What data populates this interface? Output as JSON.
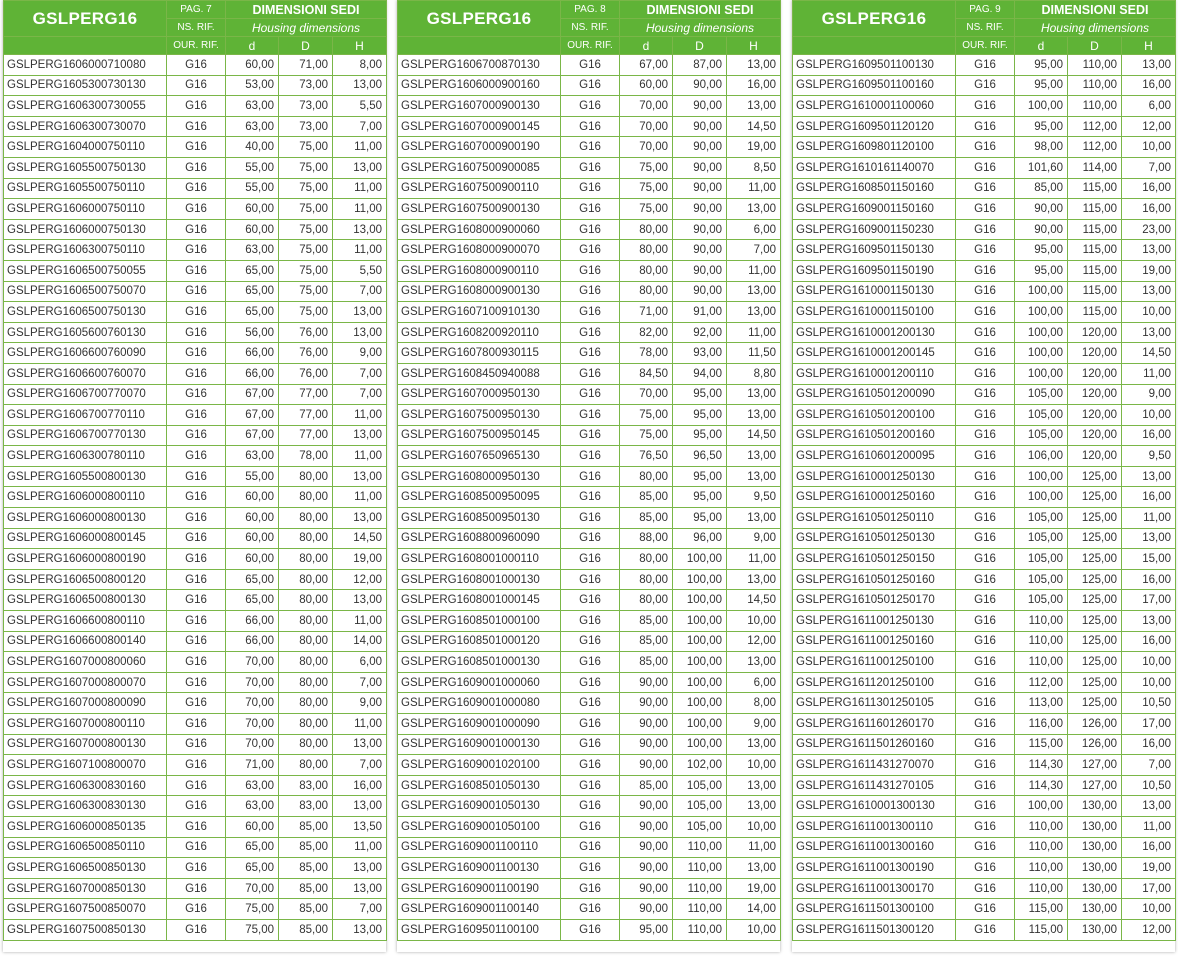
{
  "header": {
    "title": "GSLPERG16",
    "dim_title": "DIMENSIONI SEDI",
    "dim_subtitle": "Housing dimensions",
    "ns_rif": "NS. RIF.",
    "our_rif": "OUR. RIF.",
    "col_d": "d",
    "col_D": "D",
    "col_H": "H"
  },
  "tables": [
    {
      "page": "PAG. 7",
      "rows": [
        [
          "GSLPERG1606000710080",
          "G16",
          "60,00",
          "71,00",
          "8,00"
        ],
        [
          "GSLPERG1605300730130",
          "G16",
          "53,00",
          "73,00",
          "13,00"
        ],
        [
          "GSLPERG1606300730055",
          "G16",
          "63,00",
          "73,00",
          "5,50"
        ],
        [
          "GSLPERG1606300730070",
          "G16",
          "63,00",
          "73,00",
          "7,00"
        ],
        [
          "GSLPERG1604000750110",
          "G16",
          "40,00",
          "75,00",
          "11,00"
        ],
        [
          "GSLPERG1605500750130",
          "G16",
          "55,00",
          "75,00",
          "13,00"
        ],
        [
          "GSLPERG1605500750110",
          "G16",
          "55,00",
          "75,00",
          "11,00"
        ],
        [
          "GSLPERG1606000750110",
          "G16",
          "60,00",
          "75,00",
          "11,00"
        ],
        [
          "GSLPERG1606000750130",
          "G16",
          "60,00",
          "75,00",
          "13,00"
        ],
        [
          "GSLPERG1606300750110",
          "G16",
          "63,00",
          "75,00",
          "11,00"
        ],
        [
          "GSLPERG1606500750055",
          "G16",
          "65,00",
          "75,00",
          "5,50"
        ],
        [
          "GSLPERG1606500750070",
          "G16",
          "65,00",
          "75,00",
          "7,00"
        ],
        [
          "GSLPERG1606500750130",
          "G16",
          "65,00",
          "75,00",
          "13,00"
        ],
        [
          "GSLPERG1605600760130",
          "G16",
          "56,00",
          "76,00",
          "13,00"
        ],
        [
          "GSLPERG1606600760090",
          "G16",
          "66,00",
          "76,00",
          "9,00"
        ],
        [
          "GSLPERG1606600760070",
          "G16",
          "66,00",
          "76,00",
          "7,00"
        ],
        [
          "GSLPERG1606700770070",
          "G16",
          "67,00",
          "77,00",
          "7,00"
        ],
        [
          "GSLPERG1606700770110",
          "G16",
          "67,00",
          "77,00",
          "11,00"
        ],
        [
          "GSLPERG1606700770130",
          "G16",
          "67,00",
          "77,00",
          "13,00"
        ],
        [
          "GSLPERG1606300780110",
          "G16",
          "63,00",
          "78,00",
          "11,00"
        ],
        [
          "GSLPERG1605500800130",
          "G16",
          "55,00",
          "80,00",
          "13,00"
        ],
        [
          "GSLPERG1606000800110",
          "G16",
          "60,00",
          "80,00",
          "11,00"
        ],
        [
          "GSLPERG1606000800130",
          "G16",
          "60,00",
          "80,00",
          "13,00"
        ],
        [
          "GSLPERG1606000800145",
          "G16",
          "60,00",
          "80,00",
          "14,50"
        ],
        [
          "GSLPERG1606000800190",
          "G16",
          "60,00",
          "80,00",
          "19,00"
        ],
        [
          "GSLPERG1606500800120",
          "G16",
          "65,00",
          "80,00",
          "12,00"
        ],
        [
          "GSLPERG1606500800130",
          "G16",
          "65,00",
          "80,00",
          "13,00"
        ],
        [
          "GSLPERG1606600800110",
          "G16",
          "66,00",
          "80,00",
          "11,00"
        ],
        [
          "GSLPERG1606600800140",
          "G16",
          "66,00",
          "80,00",
          "14,00"
        ],
        [
          "GSLPERG1607000800060",
          "G16",
          "70,00",
          "80,00",
          "6,00"
        ],
        [
          "GSLPERG1607000800070",
          "G16",
          "70,00",
          "80,00",
          "7,00"
        ],
        [
          "GSLPERG1607000800090",
          "G16",
          "70,00",
          "80,00",
          "9,00"
        ],
        [
          "GSLPERG1607000800110",
          "G16",
          "70,00",
          "80,00",
          "11,00"
        ],
        [
          "GSLPERG1607000800130",
          "G16",
          "70,00",
          "80,00",
          "13,00"
        ],
        [
          "GSLPERG1607100800070",
          "G16",
          "71,00",
          "80,00",
          "7,00"
        ],
        [
          "GSLPERG1606300830160",
          "G16",
          "63,00",
          "83,00",
          "16,00"
        ],
        [
          "GSLPERG1606300830130",
          "G16",
          "63,00",
          "83,00",
          "13,00"
        ],
        [
          "GSLPERG1606000850135",
          "G16",
          "60,00",
          "85,00",
          "13,50"
        ],
        [
          "GSLPERG1606500850110",
          "G16",
          "65,00",
          "85,00",
          "11,00"
        ],
        [
          "GSLPERG1606500850130",
          "G16",
          "65,00",
          "85,00",
          "13,00"
        ],
        [
          "GSLPERG1607000850130",
          "G16",
          "70,00",
          "85,00",
          "13,00"
        ],
        [
          "GSLPERG1607500850070",
          "G16",
          "75,00",
          "85,00",
          "7,00"
        ],
        [
          "GSLPERG1607500850130",
          "G16",
          "75,00",
          "85,00",
          "13,00"
        ]
      ]
    },
    {
      "page": "PAG. 8",
      "rows": [
        [
          "GSLPERG1606700870130",
          "G16",
          "67,00",
          "87,00",
          "13,00"
        ],
        [
          "GSLPERG1606000900160",
          "G16",
          "60,00",
          "90,00",
          "16,00"
        ],
        [
          "GSLPERG1607000900130",
          "G16",
          "70,00",
          "90,00",
          "13,00"
        ],
        [
          "GSLPERG1607000900145",
          "G16",
          "70,00",
          "90,00",
          "14,50"
        ],
        [
          "GSLPERG1607000900190",
          "G16",
          "70,00",
          "90,00",
          "19,00"
        ],
        [
          "GSLPERG1607500900085",
          "G16",
          "75,00",
          "90,00",
          "8,50"
        ],
        [
          "GSLPERG1607500900110",
          "G16",
          "75,00",
          "90,00",
          "11,00"
        ],
        [
          "GSLPERG1607500900130",
          "G16",
          "75,00",
          "90,00",
          "13,00"
        ],
        [
          "GSLPERG1608000900060",
          "G16",
          "80,00",
          "90,00",
          "6,00"
        ],
        [
          "GSLPERG1608000900070",
          "G16",
          "80,00",
          "90,00",
          "7,00"
        ],
        [
          "GSLPERG1608000900110",
          "G16",
          "80,00",
          "90,00",
          "11,00"
        ],
        [
          "GSLPERG1608000900130",
          "G16",
          "80,00",
          "90,00",
          "13,00"
        ],
        [
          "GSLPERG1607100910130",
          "G16",
          "71,00",
          "91,00",
          "13,00"
        ],
        [
          "GSLPERG1608200920110",
          "G16",
          "82,00",
          "92,00",
          "11,00"
        ],
        [
          "GSLPERG1607800930115",
          "G16",
          "78,00",
          "93,00",
          "11,50"
        ],
        [
          "GSLPERG1608450940088",
          "G16",
          "84,50",
          "94,00",
          "8,80"
        ],
        [
          "GSLPERG1607000950130",
          "G16",
          "70,00",
          "95,00",
          "13,00"
        ],
        [
          "GSLPERG1607500950130",
          "G16",
          "75,00",
          "95,00",
          "13,00"
        ],
        [
          "GSLPERG1607500950145",
          "G16",
          "75,00",
          "95,00",
          "14,50"
        ],
        [
          "GSLPERG1607650965130",
          "G16",
          "76,50",
          "96,50",
          "13,00"
        ],
        [
          "GSLPERG1608000950130",
          "G16",
          "80,00",
          "95,00",
          "13,00"
        ],
        [
          "GSLPERG1608500950095",
          "G16",
          "85,00",
          "95,00",
          "9,50"
        ],
        [
          "GSLPERG1608500950130",
          "G16",
          "85,00",
          "95,00",
          "13,00"
        ],
        [
          "GSLPERG1608800960090",
          "G16",
          "88,00",
          "96,00",
          "9,00"
        ],
        [
          "GSLPERG1608001000110",
          "G16",
          "80,00",
          "100,00",
          "11,00"
        ],
        [
          "GSLPERG1608001000130",
          "G16",
          "80,00",
          "100,00",
          "13,00"
        ],
        [
          "GSLPERG1608001000145",
          "G16",
          "80,00",
          "100,00",
          "14,50"
        ],
        [
          "GSLPERG1608501000100",
          "G16",
          "85,00",
          "100,00",
          "10,00"
        ],
        [
          "GSLPERG1608501000120",
          "G16",
          "85,00",
          "100,00",
          "12,00"
        ],
        [
          "GSLPERG1608501000130",
          "G16",
          "85,00",
          "100,00",
          "13,00"
        ],
        [
          "GSLPERG1609001000060",
          "G16",
          "90,00",
          "100,00",
          "6,00"
        ],
        [
          "GSLPERG1609001000080",
          "G16",
          "90,00",
          "100,00",
          "8,00"
        ],
        [
          "GSLPERG1609001000090",
          "G16",
          "90,00",
          "100,00",
          "9,00"
        ],
        [
          "GSLPERG1609001000130",
          "G16",
          "90,00",
          "100,00",
          "13,00"
        ],
        [
          "GSLPERG1609001020100",
          "G16",
          "90,00",
          "102,00",
          "10,00"
        ],
        [
          "GSLPERG1608501050130",
          "G16",
          "85,00",
          "105,00",
          "13,00"
        ],
        [
          "GSLPERG1609001050130",
          "G16",
          "90,00",
          "105,00",
          "13,00"
        ],
        [
          "GSLPERG1609001050100",
          "G16",
          "90,00",
          "105,00",
          "10,00"
        ],
        [
          "GSLPERG1609001100110",
          "G16",
          "90,00",
          "110,00",
          "11,00"
        ],
        [
          "GSLPERG1609001100130",
          "G16",
          "90,00",
          "110,00",
          "13,00"
        ],
        [
          "GSLPERG1609001100190",
          "G16",
          "90,00",
          "110,00",
          "19,00"
        ],
        [
          "GSLPERG1609001100140",
          "G16",
          "90,00",
          "110,00",
          "14,00"
        ],
        [
          "GSLPERG1609501100100",
          "G16",
          "95,00",
          "110,00",
          "10,00"
        ]
      ]
    },
    {
      "page": "PAG. 9",
      "rows": [
        [
          "GSLPERG1609501100130",
          "G16",
          "95,00",
          "110,00",
          "13,00"
        ],
        [
          "GSLPERG1609501100160",
          "G16",
          "95,00",
          "110,00",
          "16,00"
        ],
        [
          "GSLPERG1610001100060",
          "G16",
          "100,00",
          "110,00",
          "6,00"
        ],
        [
          "GSLPERG1609501120120",
          "G16",
          "95,00",
          "112,00",
          "12,00"
        ],
        [
          "GSLPERG1609801120100",
          "G16",
          "98,00",
          "112,00",
          "10,00"
        ],
        [
          "GSLPERG1610161140070",
          "G16",
          "101,60",
          "114,00",
          "7,00"
        ],
        [
          "GSLPERG1608501150160",
          "G16",
          "85,00",
          "115,00",
          "16,00"
        ],
        [
          "GSLPERG1609001150160",
          "G16",
          "90,00",
          "115,00",
          "16,00"
        ],
        [
          "GSLPERG1609001150230",
          "G16",
          "90,00",
          "115,00",
          "23,00"
        ],
        [
          "GSLPERG1609501150130",
          "G16",
          "95,00",
          "115,00",
          "13,00"
        ],
        [
          "GSLPERG1609501150190",
          "G16",
          "95,00",
          "115,00",
          "19,00"
        ],
        [
          "GSLPERG1610001150130",
          "G16",
          "100,00",
          "115,00",
          "13,00"
        ],
        [
          "GSLPERG1610001150100",
          "G16",
          "100,00",
          "115,00",
          "10,00"
        ],
        [
          "GSLPERG1610001200130",
          "G16",
          "100,00",
          "120,00",
          "13,00"
        ],
        [
          "GSLPERG1610001200145",
          "G16",
          "100,00",
          "120,00",
          "14,50"
        ],
        [
          "GSLPERG1610001200110",
          "G16",
          "100,00",
          "120,00",
          "11,00"
        ],
        [
          "GSLPERG1610501200090",
          "G16",
          "105,00",
          "120,00",
          "9,00"
        ],
        [
          "GSLPERG1610501200100",
          "G16",
          "105,00",
          "120,00",
          "10,00"
        ],
        [
          "GSLPERG1610501200160",
          "G16",
          "105,00",
          "120,00",
          "16,00"
        ],
        [
          "GSLPERG1610601200095",
          "G16",
          "106,00",
          "120,00",
          "9,50"
        ],
        [
          "GSLPERG1610001250130",
          "G16",
          "100,00",
          "125,00",
          "13,00"
        ],
        [
          "GSLPERG1610001250160",
          "G16",
          "100,00",
          "125,00",
          "16,00"
        ],
        [
          "GSLPERG1610501250110",
          "G16",
          "105,00",
          "125,00",
          "11,00"
        ],
        [
          "GSLPERG1610501250130",
          "G16",
          "105,00",
          "125,00",
          "13,00"
        ],
        [
          "GSLPERG1610501250150",
          "G16",
          "105,00",
          "125,00",
          "15,00"
        ],
        [
          "GSLPERG1610501250160",
          "G16",
          "105,00",
          "125,00",
          "16,00"
        ],
        [
          "GSLPERG1610501250170",
          "G16",
          "105,00",
          "125,00",
          "17,00"
        ],
        [
          "GSLPERG1611001250130",
          "G16",
          "110,00",
          "125,00",
          "13,00"
        ],
        [
          "GSLPERG1611001250160",
          "G16",
          "110,00",
          "125,00",
          "16,00"
        ],
        [
          "GSLPERG1611001250100",
          "G16",
          "110,00",
          "125,00",
          "10,00"
        ],
        [
          "GSLPERG1611201250100",
          "G16",
          "112,00",
          "125,00",
          "10,00"
        ],
        [
          "GSLPERG1611301250105",
          "G16",
          "113,00",
          "125,00",
          "10,50"
        ],
        [
          "GSLPERG1611601260170",
          "G16",
          "116,00",
          "126,00",
          "17,00"
        ],
        [
          "GSLPERG1611501260160",
          "G16",
          "115,00",
          "126,00",
          "16,00"
        ],
        [
          "GSLPERG1611431270070",
          "G16",
          "114,30",
          "127,00",
          "7,00"
        ],
        [
          "GSLPERG1611431270105",
          "G16",
          "114,30",
          "127,00",
          "10,50"
        ],
        [
          "GSLPERG1610001300130",
          "G16",
          "100,00",
          "130,00",
          "13,00"
        ],
        [
          "GSLPERG1611001300110",
          "G16",
          "110,00",
          "130,00",
          "11,00"
        ],
        [
          "GSLPERG1611001300160",
          "G16",
          "110,00",
          "130,00",
          "16,00"
        ],
        [
          "GSLPERG1611001300190",
          "G16",
          "110,00",
          "130,00",
          "19,00"
        ],
        [
          "GSLPERG1611001300170",
          "G16",
          "110,00",
          "130,00",
          "17,00"
        ],
        [
          "GSLPERG1611501300100",
          "G16",
          "115,00",
          "130,00",
          "10,00"
        ],
        [
          "GSLPERG1611501300120",
          "G16",
          "115,00",
          "130,00",
          "12,00"
        ]
      ]
    }
  ]
}
